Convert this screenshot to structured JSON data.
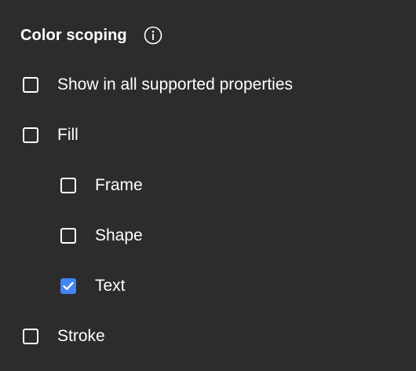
{
  "panel": {
    "title": "Color scoping",
    "info_icon": "info-circle-icon",
    "accent_color": "#4285f4",
    "background_color": "#2c2c2c"
  },
  "options": [
    {
      "label": "Show in all supported properties",
      "checked": false
    },
    {
      "label": "Fill",
      "checked": false
    },
    {
      "label": "Frame",
      "checked": false
    },
    {
      "label": "Shape",
      "checked": false
    },
    {
      "label": "Text",
      "checked": true
    },
    {
      "label": "Stroke",
      "checked": false
    }
  ]
}
